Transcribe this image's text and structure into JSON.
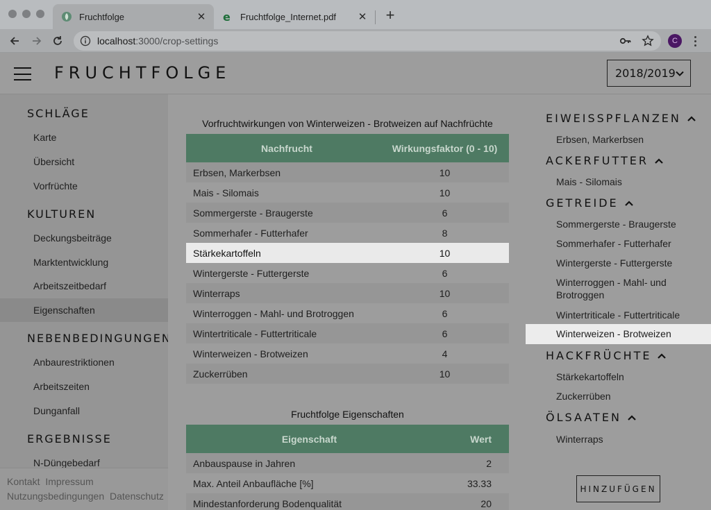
{
  "browser": {
    "tabs": [
      {
        "title": "Fruchtfolge",
        "active": true
      },
      {
        "title": "Fruchtfolge_Internet.pdf",
        "active": false
      }
    ],
    "url_host": "localhost",
    "url_path": ":3000/crop-settings",
    "profile_initial": "C"
  },
  "header": {
    "brand": "FRUCHTFOLGE",
    "year": "2018/2019"
  },
  "sidebar": {
    "sections": [
      {
        "title": "SCHLÄGE",
        "items": [
          "Karte",
          "Übersicht",
          "Vorfrüchte"
        ]
      },
      {
        "title": "KULTUREN",
        "items": [
          "Deckungsbeiträge",
          "Marktentwicklung",
          "Arbeitszeitbedarf",
          "Eigenschaften"
        ]
      },
      {
        "title": "NEBENBEDINGUNGEN",
        "items": [
          "Anbaurestriktionen",
          "Arbeitszeiten",
          "Dunganfall"
        ]
      },
      {
        "title": "ERGEBNISSE",
        "items": [
          "N-Düngebedarf"
        ]
      }
    ],
    "active_item": "Eigenschaften",
    "footer": {
      "links_row1": [
        "Kontakt",
        "Impressum"
      ],
      "links_row2": [
        "Nutzungsbedingungen",
        "Datenschutz"
      ]
    }
  },
  "main": {
    "table1": {
      "caption": "Vorfruchtwirkungen von Winterweizen - Brotweizen auf Nachfrüchte",
      "headers": [
        "Nachfrucht",
        "Wirkungsfaktor (0 - 10)"
      ],
      "rows": [
        [
          "Erbsen, Markerbsen",
          "10"
        ],
        [
          "Mais - Silomais",
          "10"
        ],
        [
          "Sommergerste - Braugerste",
          "6"
        ],
        [
          "Sommerhafer - Futterhafer",
          "8"
        ],
        [
          "Stärkekartoffeln",
          "10"
        ],
        [
          "Wintergerste - Futtergerste",
          "6"
        ],
        [
          "Winterraps",
          "10"
        ],
        [
          "Winterroggen - Mahl- und Brotroggen",
          "6"
        ],
        [
          "Wintertriticale - Futtertriticale",
          "6"
        ],
        [
          "Winterweizen - Brotweizen",
          "4"
        ],
        [
          "Zuckerrüben",
          "10"
        ]
      ],
      "highlighted_row": 4
    },
    "table2": {
      "caption": "Fruchtfolge Eigenschaften",
      "headers": [
        "Eigenschaft",
        "Wert"
      ],
      "rows": [
        [
          "Anbauspause in Jahren",
          "2"
        ],
        [
          "Max. Anteil Anbaufläche [%]",
          "33.33"
        ],
        [
          "Mindestanforderung Bodenqualität",
          "20"
        ]
      ]
    }
  },
  "crops": {
    "groups": [
      {
        "title": "EIWEISSPFLANZEN",
        "items": [
          "Erbsen, Markerbsen"
        ]
      },
      {
        "title": "ACKERFUTTER",
        "items": [
          "Mais - Silomais"
        ]
      },
      {
        "title": "GETREIDE",
        "items": [
          "Sommergerste - Braugerste",
          "Sommerhafer - Futterhafer",
          "Wintergerste - Futtergerste",
          "Winterroggen - Mahl- und Brotroggen",
          "Wintertriticale - Futtertriticale",
          "Winterweizen - Brotweizen"
        ]
      },
      {
        "title": "HACKFRÜCHTE",
        "items": [
          "Stärkekartoffeln",
          "Zuckerrüben"
        ]
      },
      {
        "title": "ÖLSAATEN",
        "items": [
          "Winterraps"
        ]
      }
    ],
    "active_item": "Winterweizen - Brotweizen",
    "add_button": "HINZUFÜGEN"
  },
  "colors": {
    "table_header": "#4e7a63",
    "highlight": "#eaeaea",
    "profile": "#4a1763"
  }
}
